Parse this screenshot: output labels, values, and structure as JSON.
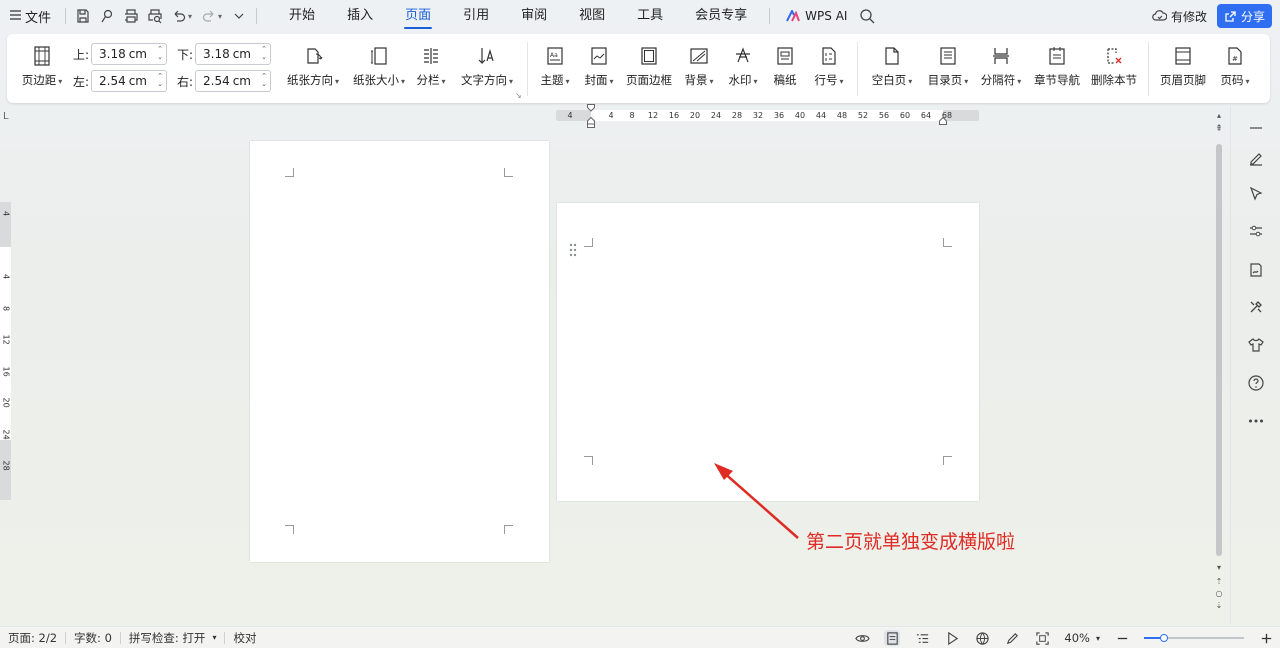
{
  "menubar": {
    "menu_icon": "hamburger-icon",
    "file_label": "文件",
    "quick_access": [
      "save-icon",
      "brush-icon",
      "print-icon",
      "print-preview-icon",
      "undo-icon",
      "redo-icon",
      "more-icon"
    ],
    "tabs": [
      {
        "label": "开始",
        "active": false
      },
      {
        "label": "插入",
        "active": false
      },
      {
        "label": "页面",
        "active": true
      },
      {
        "label": "引用",
        "active": false
      },
      {
        "label": "审阅",
        "active": false
      },
      {
        "label": "视图",
        "active": false
      },
      {
        "label": "工具",
        "active": false
      },
      {
        "label": "会员专享",
        "active": false
      }
    ],
    "wps_ai_label": "WPS AI",
    "modify_label": "有修改",
    "share_label": "分享",
    "accent_color": "#2f6ef0"
  },
  "ribbon": {
    "margins_label": "页边距",
    "margin_top_label": "上:",
    "margin_top_value": "3.18",
    "margin_bottom_label": "下:",
    "margin_bottom_value": "3.18",
    "margin_left_label": "左:",
    "margin_left_value": "2.54",
    "margin_right_label": "右:",
    "margin_right_value": "2.54",
    "unit": "cm",
    "buttons": {
      "orientation": "纸张方向",
      "size": "纸张大小",
      "columns": "分栏",
      "text_direction": "文字方向",
      "theme": "主题",
      "cover": "封面",
      "page_border": "页面边框",
      "background": "背景",
      "watermark": "水印",
      "manuscript": "稿纸",
      "line_number": "行号",
      "blank_page": "空白页",
      "toc_page": "目录页",
      "breaks": "分隔符",
      "section_nav": "章节导航",
      "delete_section": "删除本节",
      "header_footer": "页眉页脚",
      "page_number": "页码"
    }
  },
  "rulers": {
    "corner": "L",
    "horizontal_ticks": [
      "4",
      "4",
      "8",
      "12",
      "16",
      "20",
      "24",
      "28",
      "32",
      "36",
      "40",
      "44",
      "48",
      "52",
      "56",
      "60",
      "64",
      "68"
    ],
    "vertical_ticks": [
      "4",
      "4",
      "8",
      "12",
      "16",
      "20",
      "24",
      "28"
    ]
  },
  "annotation": {
    "text": "第二页就单独变成横版啦",
    "color": "#e02b25"
  },
  "sidebar_icons": [
    "minimize-icon",
    "pen-icon",
    "select-icon",
    "settings-sliders-icon",
    "sign-icon",
    "tools-icon",
    "shirt-icon",
    "help-icon",
    "more-dots-icon"
  ],
  "statusbar": {
    "page": "页面: 2/2",
    "words": "字数: 0",
    "spell_check": "拼写检查: 打开",
    "proofread": "校对",
    "zoom": "40%",
    "zoom_fraction": 0.2
  }
}
